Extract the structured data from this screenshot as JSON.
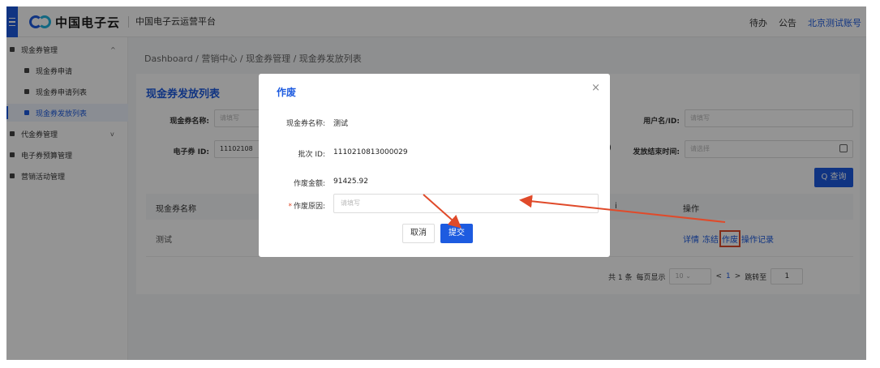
{
  "topbar": {
    "logo_text": "中国电子云",
    "platform_name": "中国电子云运营平台",
    "todo": "待办",
    "notice": "公告",
    "account": "北京测试账号"
  },
  "sidebar": {
    "items": [
      {
        "label": "现金券管理",
        "caret": "^"
      },
      {
        "label": "现金券申请"
      },
      {
        "label": "现金券申请列表"
      },
      {
        "label": "现金券发放列表"
      },
      {
        "label": "代金券管理",
        "caret": "v"
      },
      {
        "label": "电子券预算管理"
      },
      {
        "label": "营销活动管理"
      }
    ]
  },
  "breadcrumb": "Dashboard / 营销中心 / 现金券管理 / 现金券发放列表",
  "card": {
    "title": "现金券发放列表",
    "filters": {
      "coupon_name_label": "现金券名称:",
      "coupon_name_placeholder": "请填写",
      "user_label": "用户名/ID:",
      "user_placeholder": "请填写",
      "ecoupon_id_label": "电子券 ID:",
      "ecoupon_id_value": "11102108",
      "end_time_label": "发放结束时间:",
      "end_time_placeholder": "请选择",
      "partial_bracket": ")"
    },
    "query_button": "Q 查询",
    "table": {
      "col_name": "现金券名称",
      "col_partial": "i",
      "col_ops": "操作",
      "rows": [
        {
          "name": "测试"
        }
      ],
      "ops": [
        "详情",
        "冻结",
        "作废",
        "操作记录"
      ]
    },
    "pager": {
      "total": "共 1 条",
      "per_page_label": "每页显示",
      "per_page_value": "10",
      "prev": "<",
      "current": "1",
      "next": ">",
      "jump_label": "跳转至",
      "jump_value": "1"
    }
  },
  "modal": {
    "title": "作废",
    "close": "×",
    "name_label": "现金券名称:",
    "name_value": "测试",
    "batch_label": "批次 ID:",
    "batch_value": "1110210813000029",
    "amount_label": "作废金额:",
    "amount_value": "91425.92",
    "reason_required": "*",
    "reason_label": "作废原因:",
    "reason_placeholder": "请填写",
    "cancel": "取消",
    "submit": "提交"
  },
  "colors": {
    "brand": "#1d5be0",
    "annotation": "#e04a2a"
  }
}
